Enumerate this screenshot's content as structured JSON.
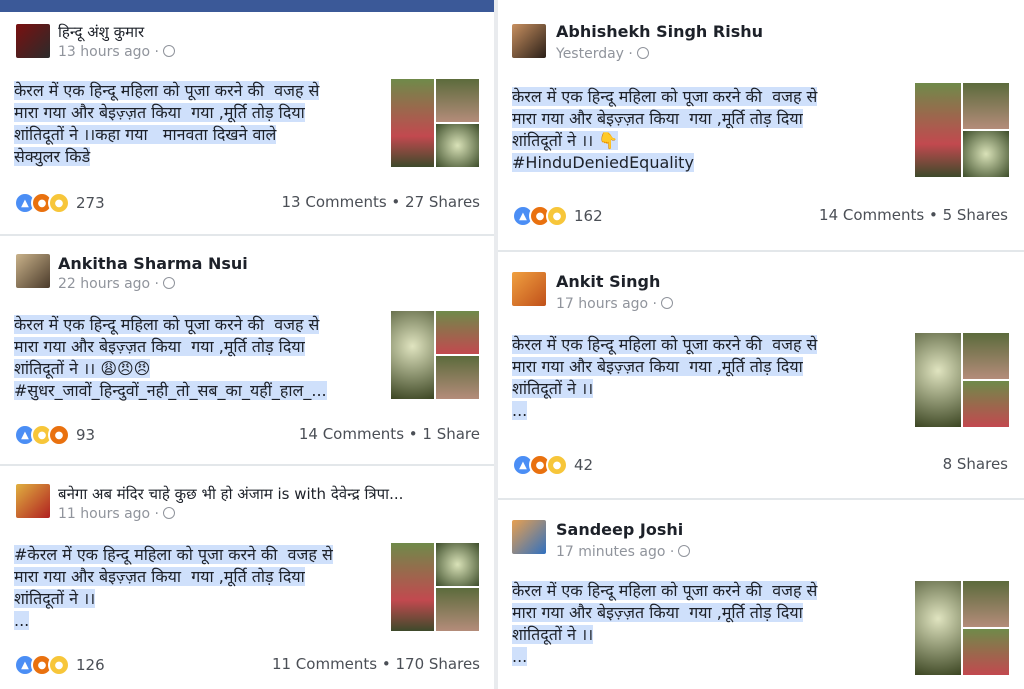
{
  "colors": {
    "facebook_blue": "#3b5998",
    "highlight": "#cfe0fb",
    "like": "#4b8ef5",
    "angry": "#e9710f",
    "sad": "#f7c63a"
  },
  "icons": {
    "globe": "globe-icon",
    "like": "like-reaction-icon",
    "angry": "angry-reaction-icon",
    "sad": "sad-reaction-icon"
  },
  "left_posts": [
    {
      "author": "हिन्दू अंशु कुमार",
      "time": "13 hours ago ·",
      "text": "केरल में एक हिन्दू महिला को पूजा करने की  वजह से\nमारा गया और बेइज़्ज़त किया  गया ,मूर्ति तोड़ दिया\nशांतिदूतों ने ।।कहा गया   मानवता दिखने वाले\nसेक्युलर किडे",
      "reaction_count": "273",
      "stats": "13 Comments • 27 Shares"
    },
    {
      "author": "Ankitha Sharma Nsui",
      "time": "22 hours ago ·",
      "text": "केरल में एक हिन्दू महिला को पूजा करने की  वजह से\nमारा गया और बेइज़्ज़त किया  गया ,मूर्ति तोड़ दिया\nशांतिदूतों ने ।। 😩😠😠\n#सुधर_जावों_हिन्दुवों_नही_तो_सब_का_यहीं_हाल_...",
      "reaction_count": "93",
      "stats": "14 Comments • 1 Share"
    },
    {
      "author": "बनेगा अब मंदिर चाहे कुछ भी हो अंजाम is with देवेन्द्र त्रिपा...",
      "time": "11 hours ago ·",
      "text": "#केरल में एक हिन्दू महिला को पूजा करने की  वजह से\nमारा गया और बेइज़्ज़त किया  गया ,मूर्ति तोड़ दिया\nशांतिदूतों ने ।।\n...",
      "reaction_count": "126",
      "stats": "11 Comments • 170 Shares"
    }
  ],
  "right_posts": [
    {
      "author": "Abhishekh Singh Rishu",
      "time": "Yesterday ·",
      "text": "केरल में एक हिन्दू महिला को पूजा करने की  वजह से\nमारा गया और बेइज़्ज़त किया  गया ,मूर्ति तोड़ दिया\nशांतिदूतों ने ।। 👇\n#HinduDeniedEquality",
      "reaction_count": "162",
      "stats": "14 Comments • 5 Shares"
    },
    {
      "author": "Ankit Singh",
      "time": "17 hours ago ·",
      "text": "केरल में एक हिन्दू महिला को पूजा करने की  वजह से\nमारा गया और बेइज़्ज़त किया  गया ,मूर्ति तोड़ दिया\nशांतिदूतों ने ।।\n...",
      "reaction_count": "42",
      "stats": "8 Shares"
    },
    {
      "author": "Sandeep Joshi",
      "time": "17 minutes ago ·",
      "text": "केरल में एक हिन्दू महिला को पूजा करने की  वजह से\nमारा गया और बेइज़्ज़त किया  गया ,मूर्ति तोड़ दिया\nशांतिदूतों ने ।।\n...",
      "reaction_count": "",
      "stats": ""
    }
  ]
}
